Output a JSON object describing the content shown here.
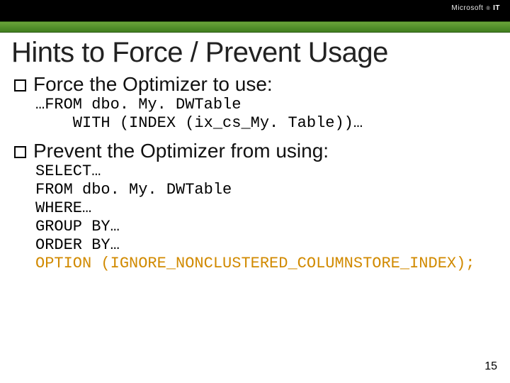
{
  "header": {
    "brand_left": "Microsoft",
    "brand_reg": "®",
    "brand_right": "IT"
  },
  "title": "Hints to Force / Prevent Usage",
  "bullets": {
    "force": {
      "text": "Force the Optimizer to use:",
      "code": "…FROM dbo. My. DWTable\n    WITH (INDEX (ix_cs_My. Table))…"
    },
    "prevent": {
      "text": "Prevent the Optimizer from using:",
      "code_plain": "SELECT…\nFROM dbo. My. DWTable\nWHERE…\nGROUP BY…\nORDER BY…",
      "code_highlight": "OPTION (IGNORE_NONCLUSTERED_COLUMNSTORE_INDEX);"
    }
  },
  "page_number": "15"
}
